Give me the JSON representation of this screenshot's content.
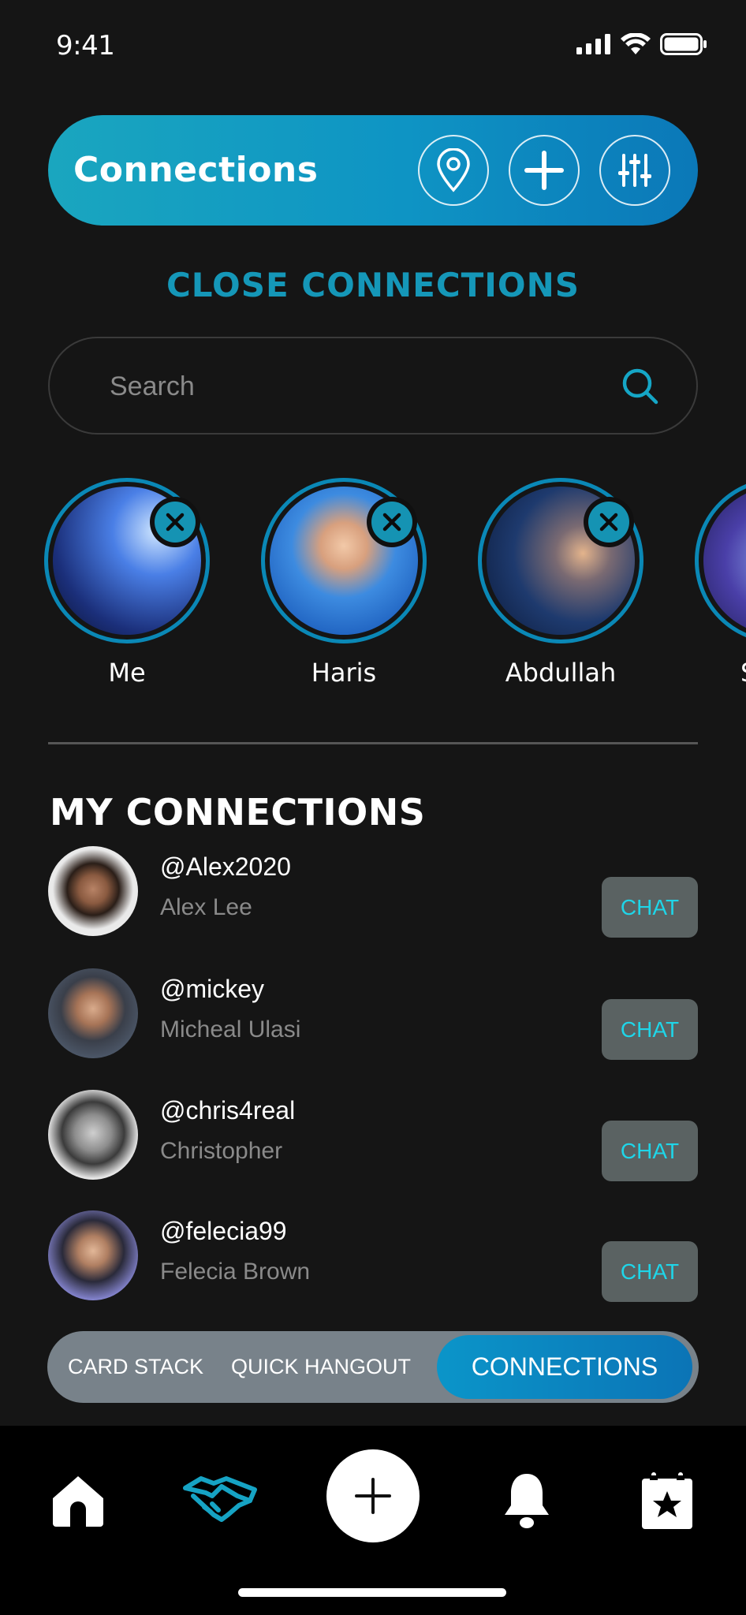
{
  "status_bar": {
    "time": "9:41"
  },
  "header": {
    "title": "Connections"
  },
  "close_connections": {
    "heading": "CLOSE CONNECTIONS",
    "search_placeholder": "Search",
    "people": [
      {
        "name": "Me"
      },
      {
        "name": "Haris"
      },
      {
        "name": "Abdullah"
      },
      {
        "name": "S"
      }
    ]
  },
  "my_connections": {
    "heading": "MY CONNECTIONS",
    "rows": [
      {
        "handle": "@Alex2020",
        "name": "Alex Lee",
        "action": "CHAT"
      },
      {
        "handle": "@mickey",
        "name": "Micheal Ulasi",
        "action": "CHAT"
      },
      {
        "handle": "@chris4real",
        "name": "Christopher",
        "action": "CHAT"
      },
      {
        "handle": "@felecia99",
        "name": "Felecia Brown",
        "action": "CHAT"
      }
    ]
  },
  "segment": {
    "items": [
      "CARD STACK",
      "QUICK HANGOUT",
      "CONNECTIONS"
    ],
    "selected": "CONNECTIONS"
  },
  "bottom_nav": {
    "items": [
      "home-icon",
      "handshake-icon",
      "plus-icon",
      "bell-icon",
      "calendar-star-icon"
    ],
    "active": "handshake-icon"
  },
  "colors": {
    "accent": "#1597b8",
    "chat_text": "#1fd5e8",
    "background": "#151515"
  }
}
